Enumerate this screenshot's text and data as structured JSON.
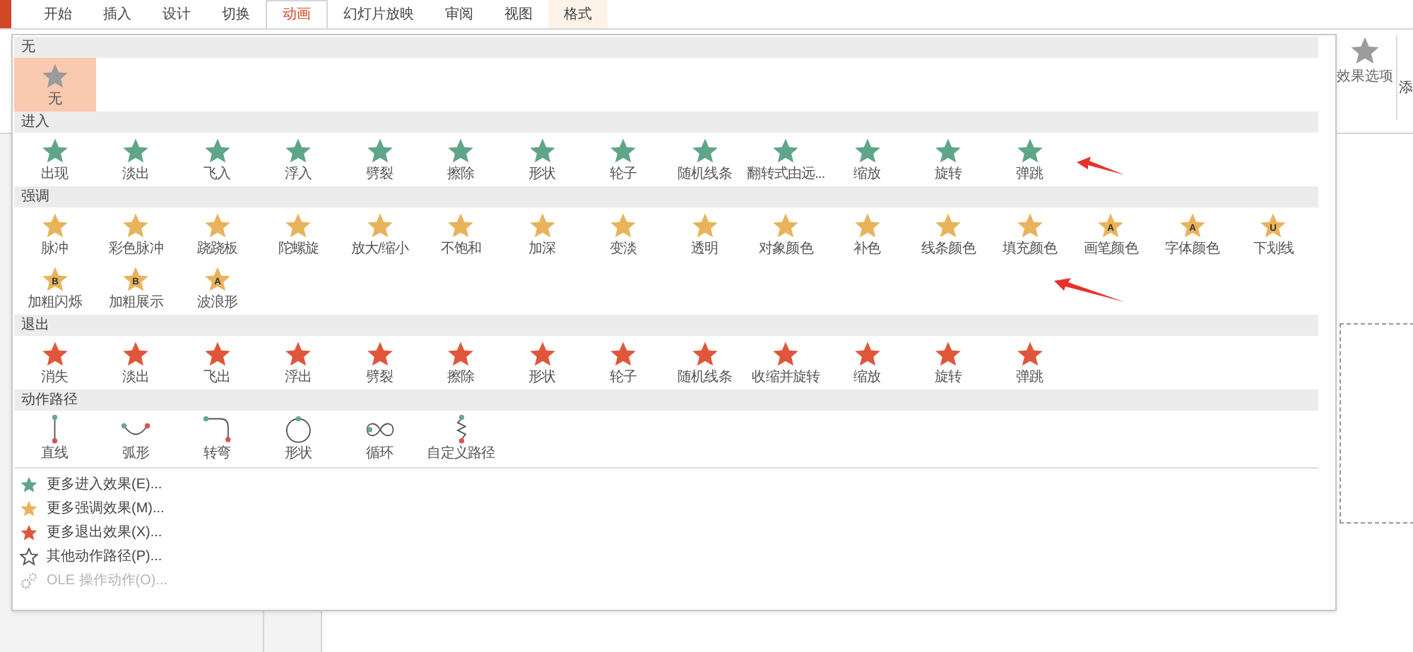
{
  "tabs": [
    {
      "label": "开始",
      "selected": false,
      "contextual": false
    },
    {
      "label": "插入",
      "selected": false,
      "contextual": false
    },
    {
      "label": "设计",
      "selected": false,
      "contextual": false
    },
    {
      "label": "切换",
      "selected": false,
      "contextual": false
    },
    {
      "label": "动画",
      "selected": true,
      "contextual": false
    },
    {
      "label": "幻灯片放映",
      "selected": false,
      "contextual": false
    },
    {
      "label": "审阅",
      "selected": false,
      "contextual": false
    },
    {
      "label": "视图",
      "selected": false,
      "contextual": false
    },
    {
      "label": "格式",
      "selected": false,
      "contextual": true
    }
  ],
  "ribbon": {
    "effect_options": "效果选项",
    "cut_label": "添"
  },
  "gallery": {
    "sections": [
      {
        "title": "无",
        "kind": "effects",
        "color": "#9b9b9b",
        "items": [
          {
            "label": "无",
            "selected": true
          }
        ]
      },
      {
        "title": "进入",
        "kind": "effects",
        "color": "#5fa58a",
        "items": [
          {
            "label": "出现",
            "selected": false
          },
          {
            "label": "淡出",
            "selected": false
          },
          {
            "label": "飞入",
            "selected": false
          },
          {
            "label": "浮入",
            "selected": false
          },
          {
            "label": "劈裂",
            "selected": false
          },
          {
            "label": "擦除",
            "selected": false
          },
          {
            "label": "形状",
            "selected": false
          },
          {
            "label": "轮子",
            "selected": false
          },
          {
            "label": "随机线条",
            "selected": false
          },
          {
            "label": "翻转式由远...",
            "selected": false
          },
          {
            "label": "缩放",
            "selected": false
          },
          {
            "label": "旋转",
            "selected": false
          },
          {
            "label": "弹跳",
            "selected": false
          }
        ]
      },
      {
        "title": "强调",
        "kind": "effects",
        "color": "#e8b35a",
        "items": [
          {
            "label": "脉冲",
            "selected": false
          },
          {
            "label": "彩色脉冲",
            "selected": false
          },
          {
            "label": "跷跷板",
            "selected": false
          },
          {
            "label": "陀螺旋",
            "selected": false
          },
          {
            "label": "放大/缩小",
            "selected": false
          },
          {
            "label": "不饱和",
            "selected": false
          },
          {
            "label": "加深",
            "selected": false
          },
          {
            "label": "变淡",
            "selected": false
          },
          {
            "label": "透明",
            "selected": false
          },
          {
            "label": "对象颜色",
            "selected": false
          },
          {
            "label": "补色",
            "selected": false
          },
          {
            "label": "线条颜色",
            "selected": false
          },
          {
            "label": "填充颜色",
            "selected": false
          },
          {
            "label": "画笔颜色",
            "selected": false,
            "glyph": "A"
          },
          {
            "label": "字体颜色",
            "selected": false,
            "glyph": "A"
          },
          {
            "label": "下划线",
            "selected": false,
            "glyph": "U"
          },
          {
            "label": "加粗闪烁",
            "selected": false,
            "glyph": "B"
          },
          {
            "label": "加粗展示",
            "selected": false,
            "glyph": "B"
          },
          {
            "label": "波浪形",
            "selected": false,
            "glyph": "A"
          }
        ]
      },
      {
        "title": "退出",
        "kind": "effects",
        "color": "#e0563a",
        "items": [
          {
            "label": "消失",
            "selected": false
          },
          {
            "label": "淡出",
            "selected": false
          },
          {
            "label": "飞出",
            "selected": false
          },
          {
            "label": "浮出",
            "selected": false
          },
          {
            "label": "劈裂",
            "selected": false
          },
          {
            "label": "擦除",
            "selected": false
          },
          {
            "label": "形状",
            "selected": false
          },
          {
            "label": "轮子",
            "selected": false
          },
          {
            "label": "随机线条",
            "selected": false
          },
          {
            "label": "收缩并旋转",
            "selected": false
          },
          {
            "label": "缩放",
            "selected": false
          },
          {
            "label": "旋转",
            "selected": false
          },
          {
            "label": "弹跳",
            "selected": false
          }
        ]
      },
      {
        "title": "动作路径",
        "kind": "paths",
        "items": [
          {
            "label": "直线",
            "selected": false,
            "kind": "line"
          },
          {
            "label": "弧形",
            "selected": false,
            "kind": "arc"
          },
          {
            "label": "转弯",
            "selected": false,
            "kind": "turn"
          },
          {
            "label": "形状",
            "selected": false,
            "kind": "circle"
          },
          {
            "label": "循环",
            "selected": false,
            "kind": "loop"
          },
          {
            "label": "自定义路径",
            "selected": false,
            "kind": "custom"
          }
        ]
      }
    ]
  },
  "menu": [
    {
      "label": "更多进入效果(E)...",
      "color": "#5fa58a",
      "kind": "star",
      "disabled": false
    },
    {
      "label": "更多强调效果(M)...",
      "color": "#e8b35a",
      "kind": "star",
      "disabled": false
    },
    {
      "label": "更多退出效果(X)...",
      "color": "#e0563a",
      "kind": "star",
      "disabled": false
    },
    {
      "label": "其他动作路径(P)...",
      "kind": "outline",
      "disabled": false
    },
    {
      "label": "OLE 操作动作(O)...",
      "kind": "gears",
      "disabled": true
    }
  ]
}
